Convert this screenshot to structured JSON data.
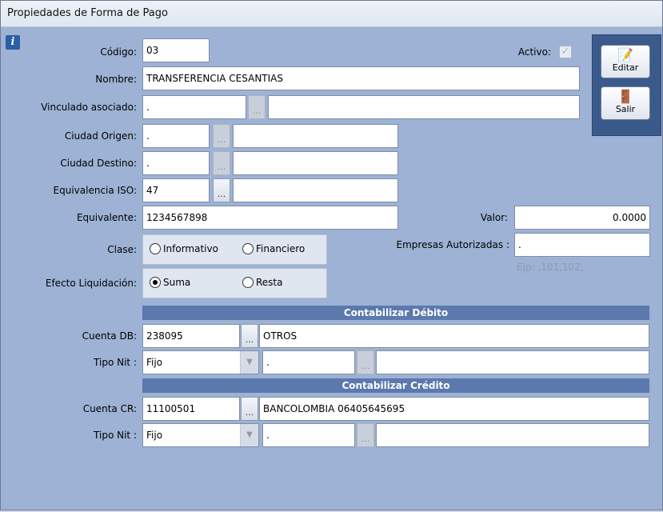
{
  "window": {
    "title": "Propiedades de Forma de Pago"
  },
  "toolbar": {
    "edit_label": "Editar",
    "exit_label": "Salir"
  },
  "form": {
    "codigo": {
      "label": "Código:",
      "value": "03"
    },
    "activo": {
      "label": "Activo:",
      "checked": true
    },
    "nombre": {
      "label": "Nombre:",
      "value": "TRANSFERENCIA CESANTIAS"
    },
    "vinculado": {
      "label": "Vinculado asociado:",
      "code": ".",
      "desc": ""
    },
    "ciudad_origen": {
      "label": "Ciudad Origen:",
      "code": ".",
      "desc": ""
    },
    "ciudad_destino": {
      "label": "Ciudad Destino:",
      "code": ".",
      "desc": ""
    },
    "equivalencia_iso": {
      "label": "Equivalencia ISO:",
      "code": "47",
      "desc": ""
    },
    "equivalente": {
      "label": "Equivalente:",
      "value": "1234567898"
    },
    "valor": {
      "label": "Valor:",
      "value": "0.0000"
    },
    "clase": {
      "label": "Clase:",
      "options": [
        "Informativo",
        "Financiero"
      ],
      "selected": null
    },
    "empresas": {
      "label": "Empresas Autorizadas :",
      "value": ".",
      "hint": "Ejp: ,101,102,"
    },
    "efecto": {
      "label": "Efecto Liquidación:",
      "options": [
        "Suma",
        "Resta"
      ],
      "selected": "Suma"
    },
    "debito": {
      "section": "Contabilizar Débito",
      "cuenta_label": "Cuenta DB:",
      "cuenta_code": "238095",
      "cuenta_desc": "OTROS",
      "tipo_label": "Tipo Nit :",
      "tipo_value": "Fijo",
      "nit_code": ".",
      "nit_desc": ""
    },
    "credito": {
      "section": "Contabilizar Crédito",
      "cuenta_label": "Cuenta CR:",
      "cuenta_code": "11100501",
      "cuenta_desc": "BANCOLOMBIA 06405645695",
      "tipo_label": "Tipo Nit :",
      "tipo_value": "Fijo",
      "nit_code": ".",
      "nit_desc": ""
    },
    "dots_label": "..."
  }
}
